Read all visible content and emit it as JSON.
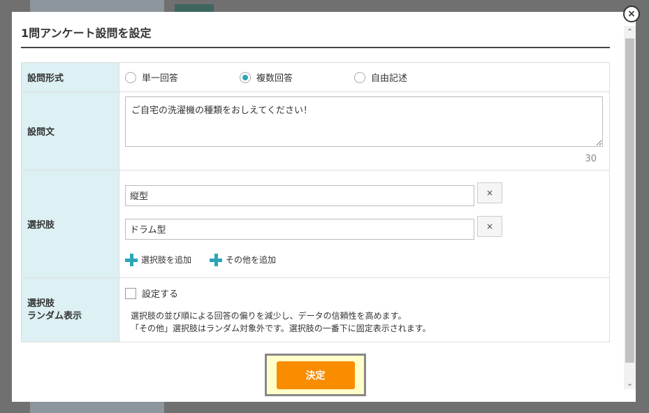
{
  "modal": {
    "title": "1問アンケート設問を設定",
    "close_label": "×"
  },
  "question_type": {
    "label": "設問形式",
    "options": [
      {
        "label": "単一回答",
        "checked": false
      },
      {
        "label": "複数回答",
        "checked": true
      },
      {
        "label": "自由記述",
        "checked": false
      }
    ]
  },
  "question_text": {
    "label": "設問文",
    "value": "ご自宅の洗濯機の種類をおしえてください！",
    "remaining_chars": "30"
  },
  "choices": {
    "label": "選択肢",
    "items": [
      {
        "value": "縦型",
        "delete_label": "×"
      },
      {
        "value": "ドラム型",
        "delete_label": "×"
      }
    ],
    "add_choice_label": "選択肢を追加",
    "add_other_label": "その他を追加"
  },
  "random": {
    "label_line1": "選択肢",
    "label_line2": "ランダム表示",
    "checkbox_label": "設定する",
    "checked": false,
    "note_line1": "選択肢の並び順による回答の偏りを減少し、データの信頼性を高めます。",
    "note_line2": "「その他」選択肢はランダム対象外です。選択肢の一番下に固定表示されます。"
  },
  "submit": {
    "label": "決定"
  },
  "scrollbar": {
    "up_icon": "chevron-up-icon",
    "down_icon": "chevron-down-icon"
  },
  "colors": {
    "accent": "#2aa6b8",
    "label_bg": "#ddf0f3",
    "submit": "#fa8c00"
  }
}
